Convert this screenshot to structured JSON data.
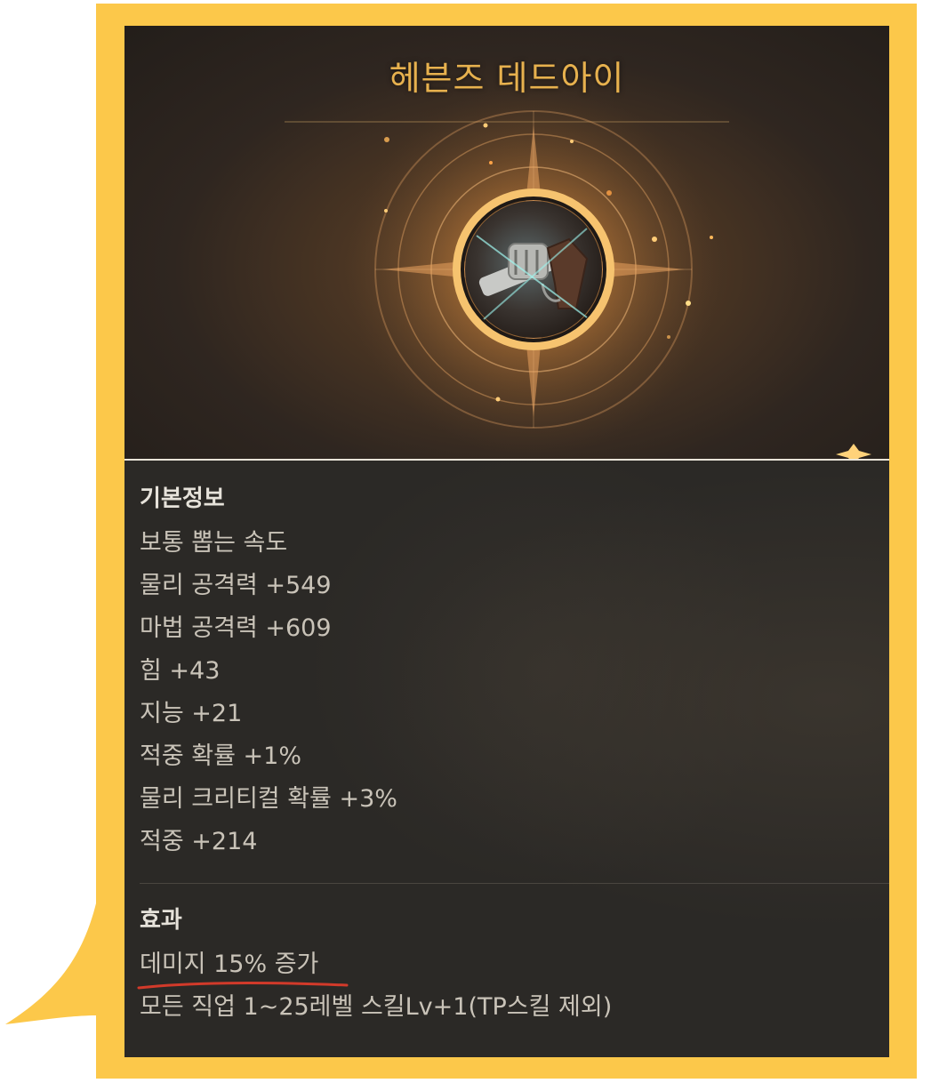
{
  "item": {
    "name": "헤븐즈 데드아이"
  },
  "basic_info": {
    "heading": "기본정보",
    "stats": [
      {
        "text": "보통 뽑는 속도"
      },
      {
        "text": "물리 공격력 +549"
      },
      {
        "text": "마법 공격력 +609"
      },
      {
        "text": "힘 +43"
      },
      {
        "text": "지능 +21"
      },
      {
        "text": "적중 확률 +1%"
      },
      {
        "text": "물리 크리티컬 확률 +3%"
      },
      {
        "text": "적중 +214"
      }
    ]
  },
  "effects": {
    "heading": "효과",
    "lines": [
      {
        "text": "데미지 15% 증가"
      },
      {
        "text": "모든 직업 1~25레벨 스킬Lv+1(TP스킬 제외)"
      }
    ]
  },
  "icons": {
    "item_icon": "revolver-icon"
  },
  "colors": {
    "bubble": "#fcc84a",
    "title_gold": "#e7b14e",
    "highlight_underline": "#d23a2a"
  }
}
